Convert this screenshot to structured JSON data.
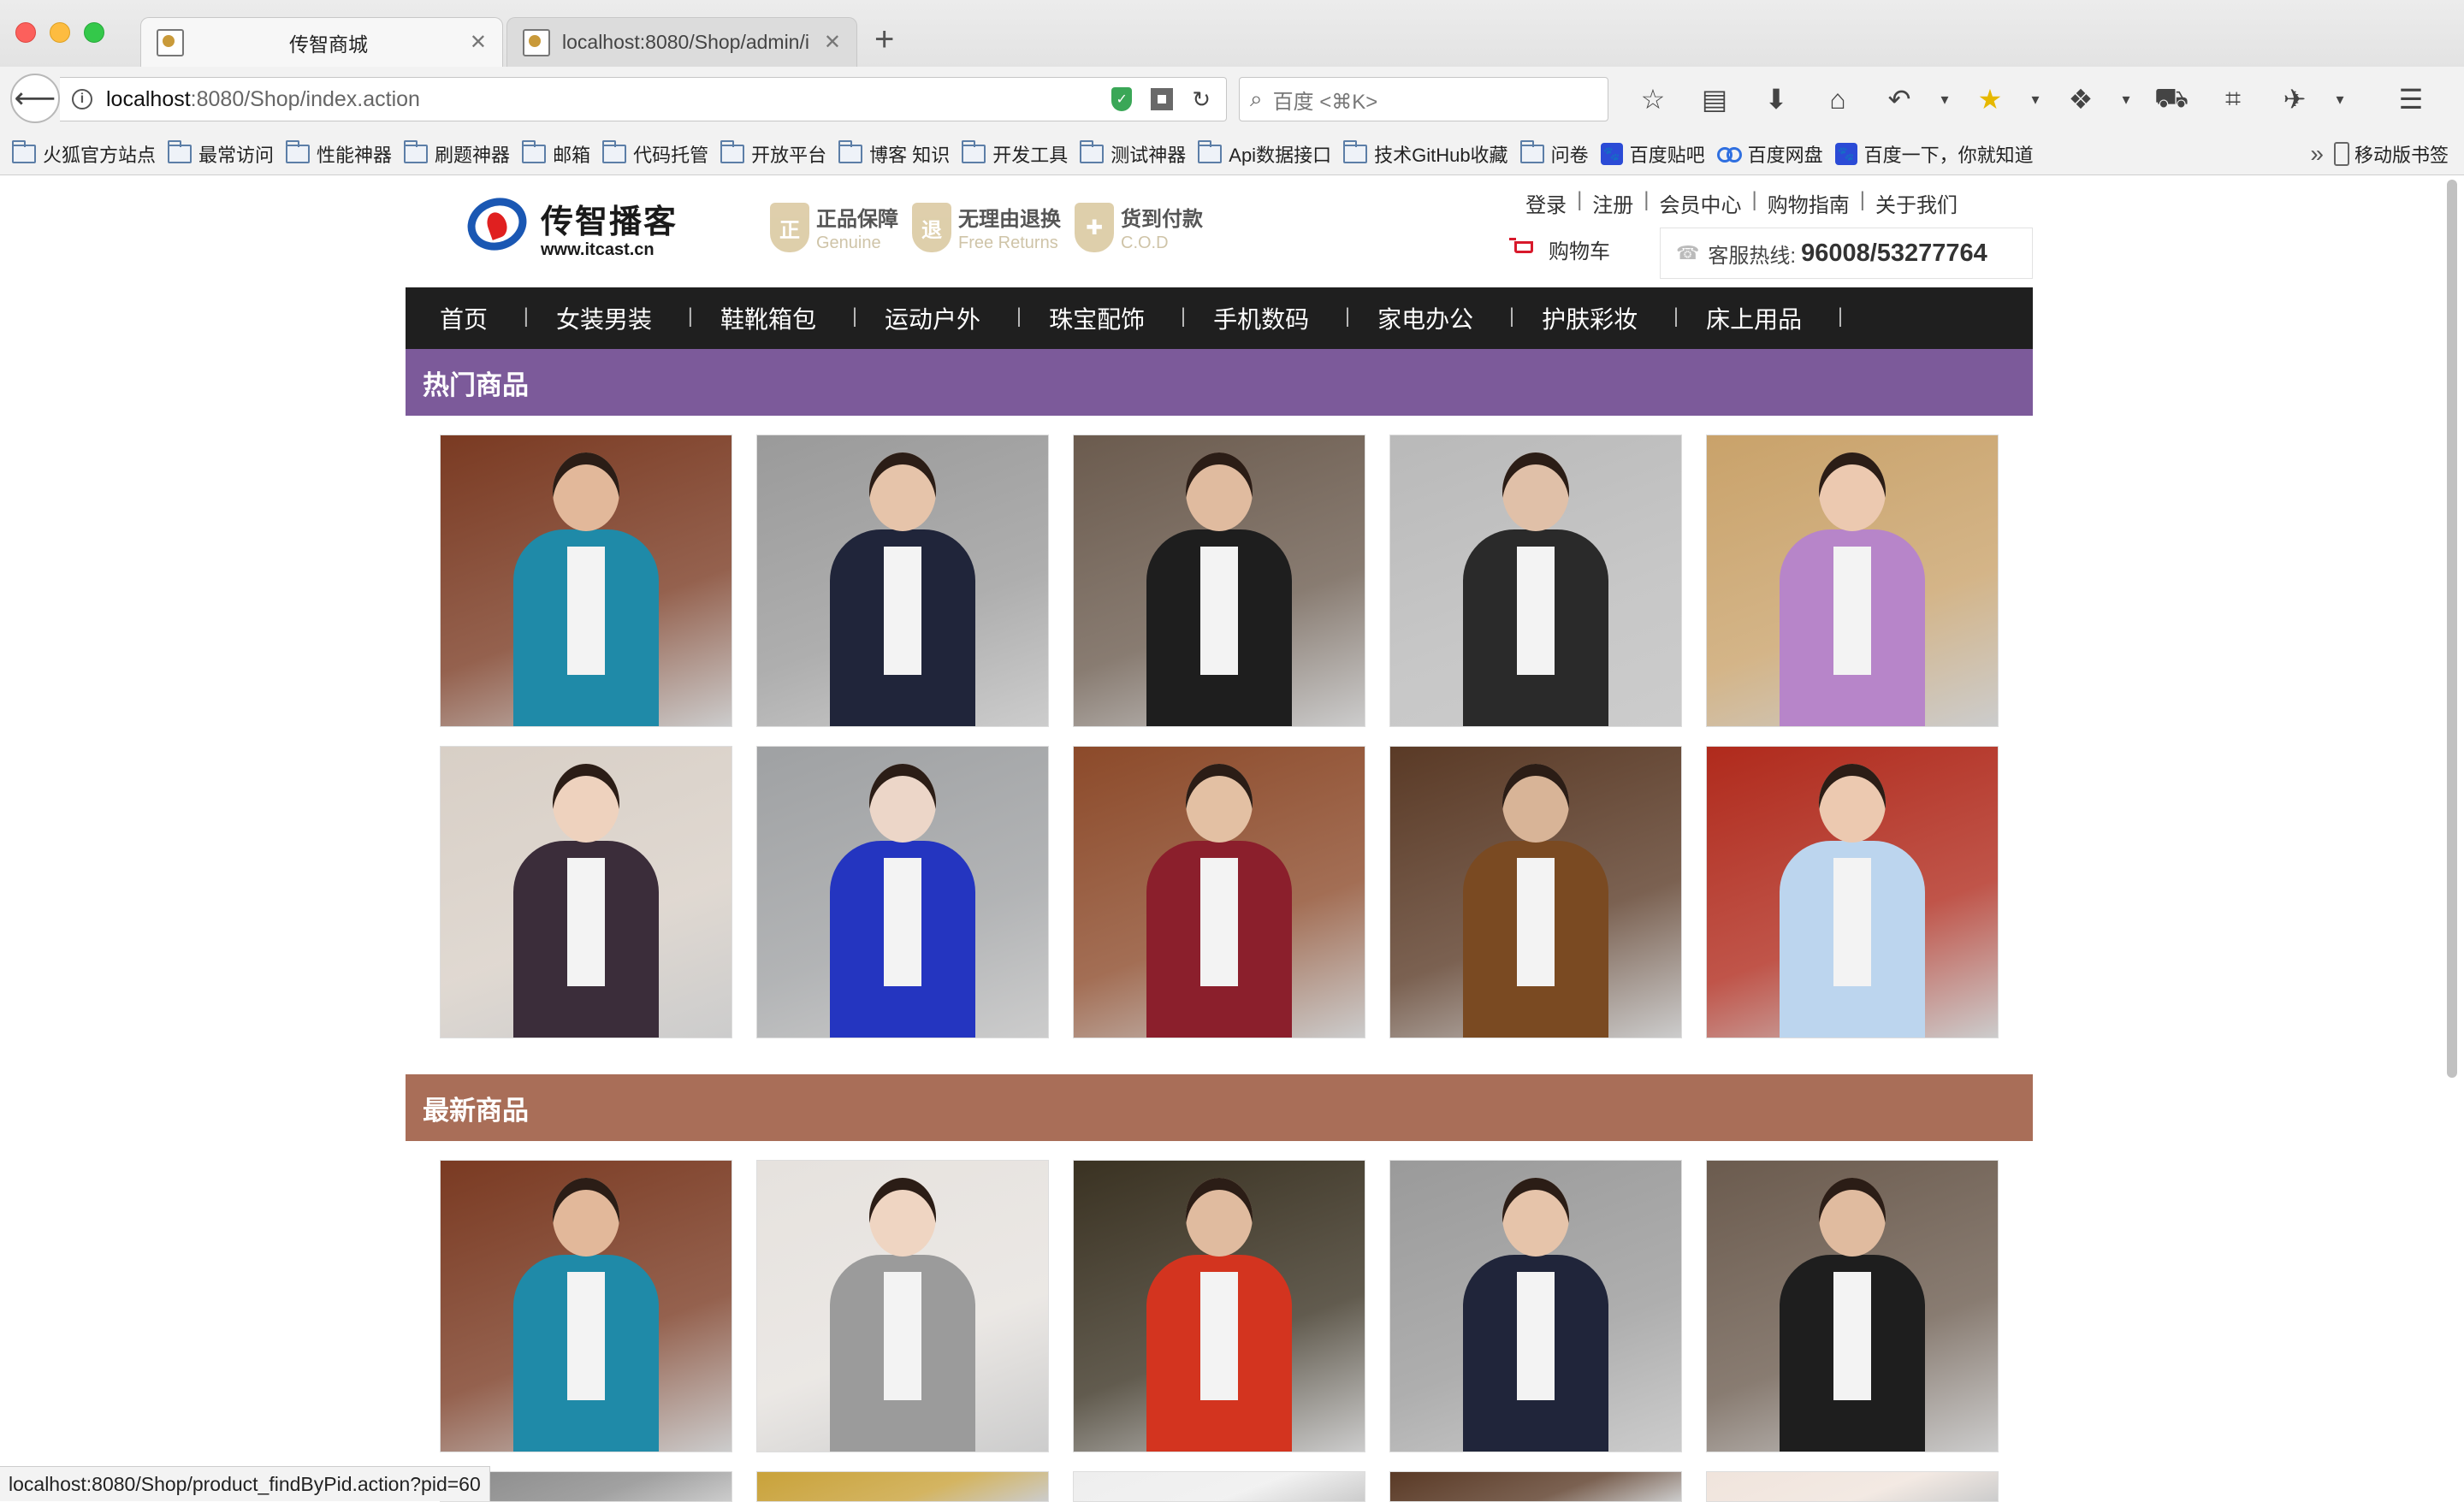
{
  "browser": {
    "tabs": [
      {
        "title": "传智商城",
        "active": true
      },
      {
        "title": "localhost:8080/Shop/admin/i",
        "active": false
      }
    ],
    "new_tab_label": "+",
    "url_host": "localhost",
    "url_path": ":8080/Shop/index.action",
    "search_placeholder": "百度 <⌘K>",
    "bookmarks": [
      {
        "label": "火狐官方站点",
        "icon": "folder-icon"
      },
      {
        "label": "最常访问",
        "icon": "folder-icon"
      },
      {
        "label": "性能神器",
        "icon": "folder-icon"
      },
      {
        "label": "刷题神器",
        "icon": "folder-icon"
      },
      {
        "label": "邮箱",
        "icon": "folder-icon"
      },
      {
        "label": "代码托管",
        "icon": "folder-icon"
      },
      {
        "label": "开放平台",
        "icon": "folder-icon"
      },
      {
        "label": "博客 知识",
        "icon": "folder-icon"
      },
      {
        "label": "开发工具",
        "icon": "folder-icon"
      },
      {
        "label": "测试神器",
        "icon": "folder-icon"
      },
      {
        "label": "Api数据接口",
        "icon": "folder-icon"
      },
      {
        "label": "技术GitHub收藏",
        "icon": "folder-icon"
      },
      {
        "label": "问卷",
        "icon": "folder-icon"
      },
      {
        "label": "百度贴吧",
        "icon": "paw-icon"
      },
      {
        "label": "百度网盘",
        "icon": "cloud-icon"
      },
      {
        "label": "百度一下，你就知道",
        "icon": "paw-icon"
      }
    ],
    "bookmarks_overflow": "»",
    "mobile_bookmarks": "移动版书签",
    "status_url": "localhost:8080/Shop/product_findByPid.action?pid=60"
  },
  "site": {
    "logo_cn": "传智播客",
    "logo_en": "www.itcast.cn",
    "guarantees": [
      {
        "badge": "正",
        "cn": "正品保障",
        "en": "Genuine"
      },
      {
        "badge": "退",
        "cn": "无理由退换",
        "en": "Free Returns"
      },
      {
        "badge": "✚",
        "cn": "货到付款",
        "en": "C.O.D"
      }
    ],
    "top_links": [
      "登录",
      "注册",
      "会员中心",
      "购物指南",
      "关于我们"
    ],
    "cart_label": "购物车",
    "hotline_label": "客服热线:",
    "hotline_number": "96008/53277764",
    "nav": [
      "首页",
      "女装男装",
      "鞋靴箱包",
      "运动户外",
      "珠宝配饰",
      "手机数码",
      "家电办公",
      "护肤彩妆",
      "床上用品"
    ],
    "hot_title": "热门商品",
    "new_title": "最新商品"
  },
  "products": {
    "hot": [
      {
        "bg": "#7a3a22",
        "coat": "#1f8aa8",
        "skin": "#e2b89a"
      },
      {
        "bg": "#9a9a9a",
        "coat": "#20253a",
        "skin": "#e6c4aa"
      },
      {
        "bg": "#6b5b4e",
        "coat": "#1e1e1e",
        "skin": "#e0bb9f"
      },
      {
        "bg": "#b9b9b9",
        "coat": "#2a2a2a",
        "skin": "#e0c0a8"
      },
      {
        "bg": "#c9a26a",
        "coat": "#b785c9",
        "skin": "#ecc9b0"
      },
      {
        "bg": "#d8cfc6",
        "coat": "#3b2d3a",
        "skin": "#eed2be"
      },
      {
        "bg": "#9fa1a3",
        "coat": "#2435c0",
        "skin": "#ecd6c8"
      },
      {
        "bg": "#8c4a2a",
        "coat": "#8b1f2c",
        "skin": "#e3c0a3"
      },
      {
        "bg": "#5a3a26",
        "coat": "#7a4a22",
        "skin": "#d8b497"
      },
      {
        "bg": "#b02a1c",
        "coat": "#bcd5ee",
        "skin": "#ecc9b0"
      }
    ],
    "new": [
      {
        "bg": "#7a3a22",
        "coat": "#1f8aa8",
        "skin": "#e2b89a"
      },
      {
        "bg": "#e6e2de",
        "coat": "#9b9b9b",
        "skin": "#efd5c2"
      },
      {
        "bg": "#3a3222",
        "coat": "#d3341f",
        "skin": "#e0bb9f"
      },
      {
        "bg": "#9a9a9a",
        "coat": "#20253a",
        "skin": "#e6c4aa"
      },
      {
        "bg": "#6b5b4e",
        "coat": "#1e1e1e",
        "skin": "#e0bb9f"
      }
    ],
    "partial": [
      {
        "bg": "#8a8a8a"
      },
      {
        "bg": "#c9a23a"
      },
      {
        "bg": "#eeeeee"
      },
      {
        "bg": "#5a3a26"
      },
      {
        "bg": "#f0e4dc"
      }
    ]
  }
}
